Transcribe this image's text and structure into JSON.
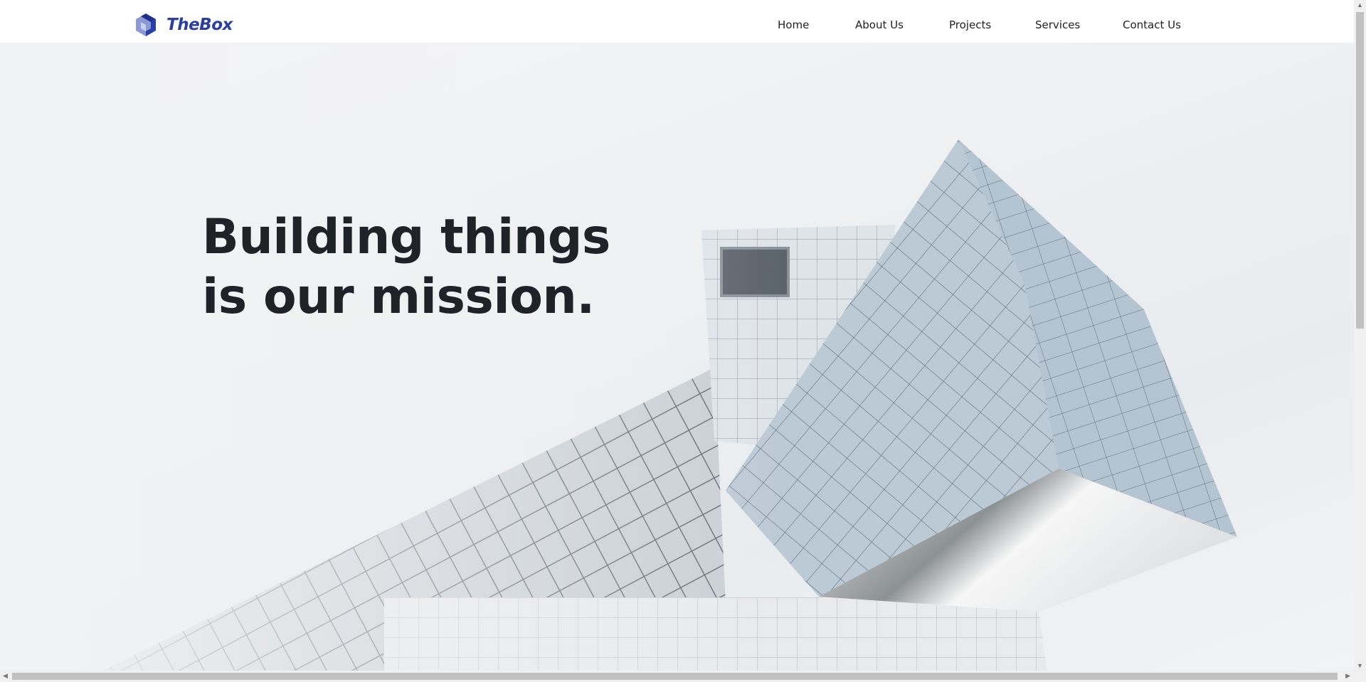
{
  "header": {
    "logo_text": "TheBox",
    "logo_icon": "cube-icon",
    "brand_color": "#2a3f9e",
    "nav": [
      {
        "label": "Home"
      },
      {
        "label": "About Us"
      },
      {
        "label": "Projects"
      },
      {
        "label": "Services"
      },
      {
        "label": "Contact Us"
      }
    ]
  },
  "hero": {
    "headline_line1": "Building things",
    "headline_line2": "is our mission.",
    "background_image": "modern-glass-building-photo"
  }
}
